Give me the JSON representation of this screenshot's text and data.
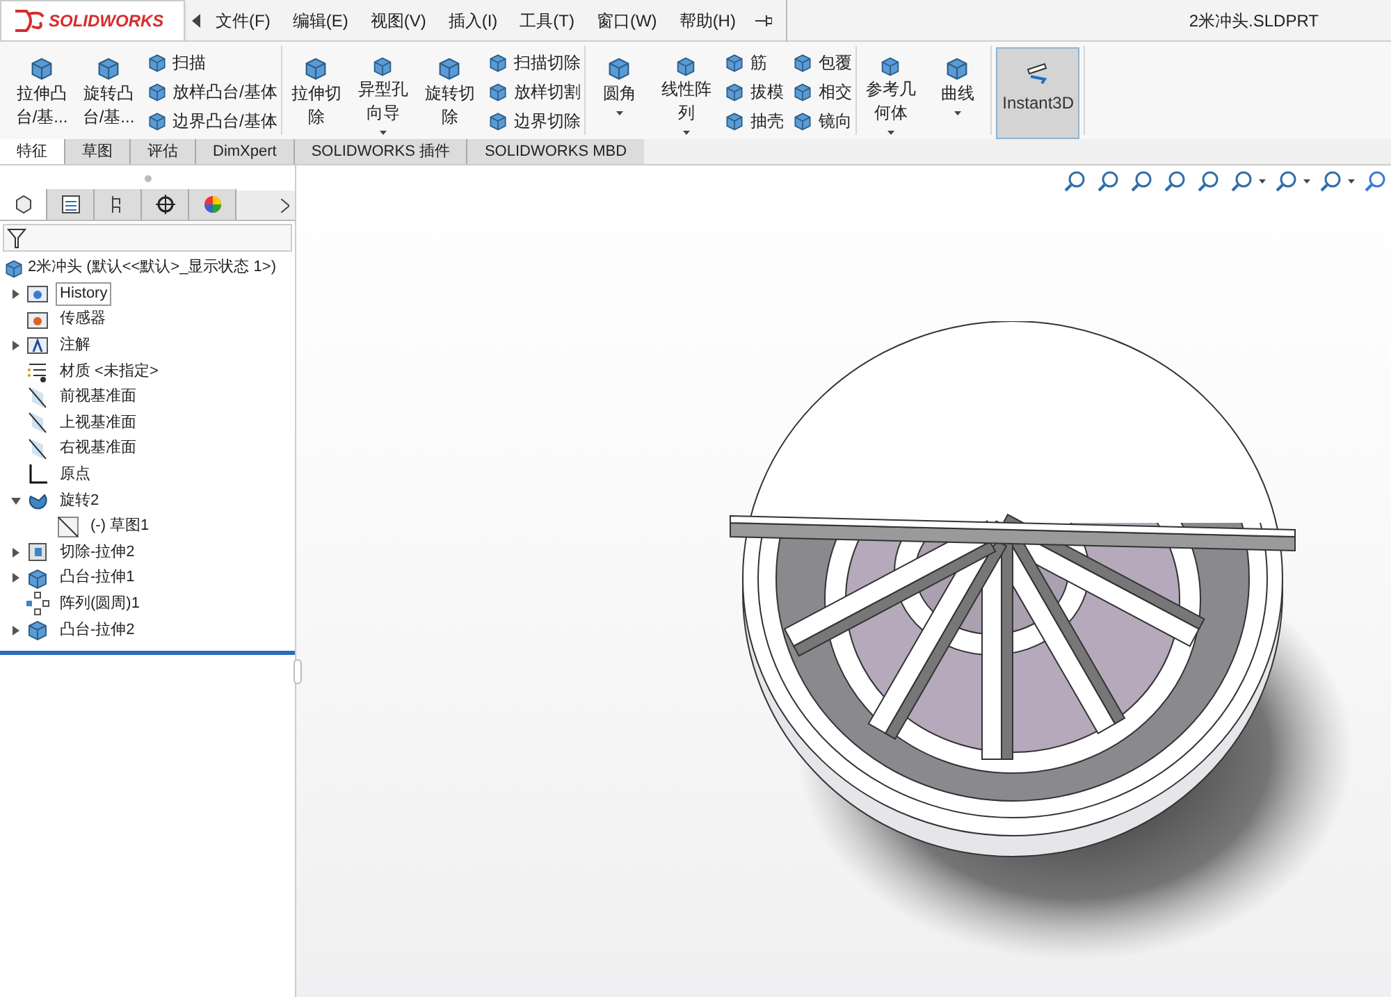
{
  "title_bar": {
    "logo": "SOLIDWORKS",
    "menu": [
      "文件(F)",
      "编辑(E)",
      "视图(V)",
      "插入(I)",
      "工具(T)",
      "窗口(W)",
      "帮助(H)"
    ],
    "document_title": "2米冲头.SLDPRT"
  },
  "ribbon": {
    "groups": [
      {
        "items": [
          {
            "kind": "large",
            "label": "拉伸凸台/基...",
            "dropdown": false
          },
          {
            "kind": "large",
            "label": "旋转凸台/基...",
            "dropdown": false
          },
          {
            "kind": "column",
            "entries": [
              "扫描",
              "放样凸台/基体",
              "边界凸台/基体"
            ]
          }
        ]
      },
      {
        "items": [
          {
            "kind": "large",
            "label": "拉伸切除",
            "dropdown": false
          },
          {
            "kind": "large",
            "label": "异型孔向导",
            "dropdown": true
          },
          {
            "kind": "large",
            "label": "旋转切除",
            "dropdown": false
          },
          {
            "kind": "column",
            "entries": [
              "扫描切除",
              "放样切割",
              "边界切除"
            ]
          }
        ]
      },
      {
        "items": [
          {
            "kind": "large",
            "label": "圆角",
            "dropdown": true
          },
          {
            "kind": "large",
            "label": "线性阵列",
            "dropdown": true
          },
          {
            "kind": "column",
            "entries": [
              "筋",
              "拔模",
              "抽壳"
            ]
          },
          {
            "kind": "column",
            "entries": [
              "包覆",
              "相交",
              "镜向"
            ]
          }
        ]
      },
      {
        "items": [
          {
            "kind": "large",
            "label": "参考几何体",
            "dropdown": true
          },
          {
            "kind": "large",
            "label": "曲线",
            "dropdown": true
          }
        ]
      },
      {
        "items": [
          {
            "kind": "toggle",
            "label": "Instant3D",
            "selected": true
          }
        ]
      }
    ]
  },
  "tabs": [
    {
      "label": "特征",
      "selected": true
    },
    {
      "label": "草图",
      "selected": false
    },
    {
      "label": "评估",
      "selected": false
    },
    {
      "label": "DimXpert",
      "selected": false
    },
    {
      "label": "SOLIDWORKS 插件",
      "selected": false
    },
    {
      "label": "SOLIDWORKS MBD",
      "selected": false
    }
  ],
  "panel_tabs": [
    {
      "selected": true
    },
    {
      "selected": false
    },
    {
      "selected": false
    },
    {
      "selected": false
    },
    {
      "selected": false
    }
  ],
  "tree": {
    "root": "2米冲头  (默认<<默认>_显示状态 1>)",
    "items": [
      {
        "kind": "history",
        "label": "History",
        "expanded": false,
        "selected": true
      },
      {
        "kind": "sensor",
        "label": "传感器",
        "selected": false
      },
      {
        "kind": "annotation",
        "label": "注解",
        "expanded": false,
        "selected": false
      },
      {
        "kind": "material",
        "label": "材质 <未指定>",
        "selected": false
      },
      {
        "kind": "plane",
        "label": "前视基准面",
        "selected": false
      },
      {
        "kind": "plane",
        "label": "上视基准面",
        "selected": false
      },
      {
        "kind": "plane",
        "label": "右视基准面",
        "selected": false
      },
      {
        "kind": "origin",
        "label": "原点",
        "selected": false
      },
      {
        "kind": "revolve",
        "label": "旋转2",
        "expanded": true,
        "selected": false,
        "children": [
          {
            "kind": "sketch",
            "label": "(-) 草图1",
            "selected": false
          }
        ]
      },
      {
        "kind": "cut",
        "label": "切除-拉伸2",
        "expanded": false,
        "selected": false
      },
      {
        "kind": "boss",
        "label": "凸台-拉伸1",
        "expanded": false,
        "selected": false
      },
      {
        "kind": "pattern",
        "label": "阵列(圆周)1",
        "selected": false
      },
      {
        "kind": "boss",
        "label": "凸台-拉伸2",
        "expanded": false,
        "selected": false
      }
    ]
  }
}
